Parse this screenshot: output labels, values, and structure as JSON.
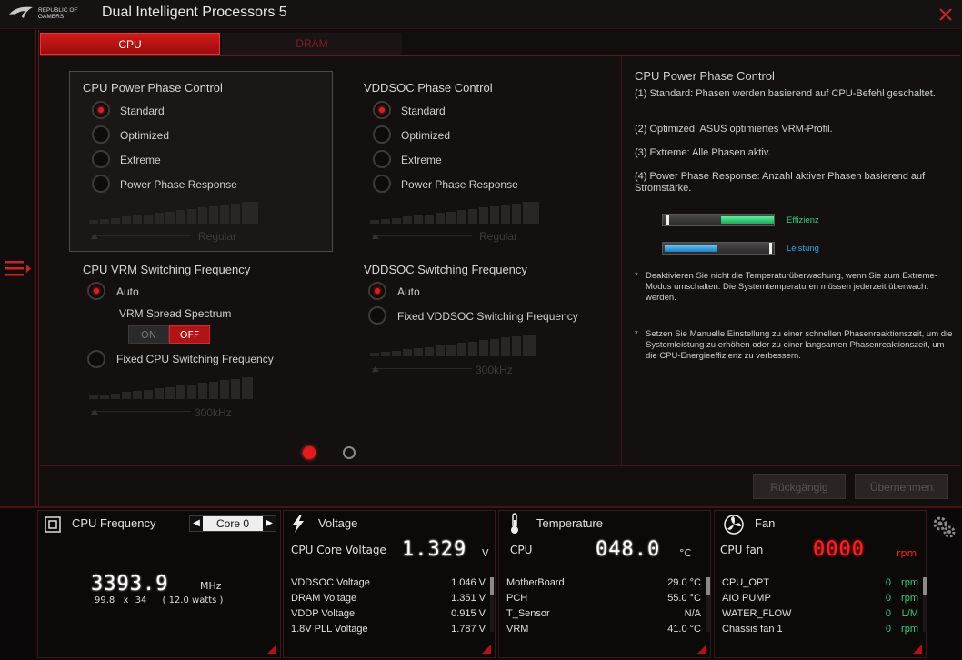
{
  "app": {
    "brand_line1": "REPUBLIC OF",
    "brand_line2": "GAMERS",
    "title": "Dual Intelligent Processors 5"
  },
  "tabs": [
    {
      "label": "CPU",
      "active": true
    },
    {
      "label": "DRAM",
      "active": false
    }
  ],
  "cpu_phase": {
    "title": "CPU Power Phase Control",
    "options": [
      "Standard",
      "Optimized",
      "Extreme",
      "Power Phase Response"
    ],
    "selected": "Standard",
    "slider_label": "Regular"
  },
  "vddsoc_phase": {
    "title": "VDDSOC Phase Control",
    "options": [
      "Standard",
      "Optimized",
      "Extreme",
      "Power Phase Response"
    ],
    "selected": "Standard",
    "slider_label": "Regular"
  },
  "cpu_vrm": {
    "title": "CPU VRM Switching Frequency",
    "auto_label": "Auto",
    "spread_label": "VRM Spread Spectrum",
    "toggle_on": "ON",
    "toggle_off": "OFF",
    "toggle_state": "OFF",
    "fixed_label": "Fixed CPU Switching Frequency",
    "slider_label": "300kHz",
    "selected": "Auto"
  },
  "vddsoc_sw": {
    "title": "VDDSOC Switching Frequency",
    "auto_label": "Auto",
    "fixed_label": "Fixed VDDSOC Switching Frequency",
    "slider_label": "300kHz",
    "selected": "Auto"
  },
  "pager": {
    "pages": 2,
    "current": 1
  },
  "description": {
    "title": "CPU Power Phase Control",
    "p1": "(1) Standard: Phasen werden basierend auf CPU-Befehl geschaltet.",
    "p2": "(2) Optimized: ASUS optimiertes VRM-Profil.",
    "p3": "(3) Extreme: Alle Phasen aktiv.",
    "p4": "(4) Power Phase Response: Anzahl aktiver Phasen basierend auf Stromstärke.",
    "bar1_label": "Effizienz",
    "bar1_color": "#2fd07a",
    "bar2_label": "Leistung",
    "bar2_color": "#2aa8e0",
    "note1": "Deaktivieren Sie nicht die Temperaturüberwachung, wenn Sie zum Extreme-Modus umschalten. Die Systemtemperaturen müssen jederzeit überwacht werden.",
    "note2": "Setzen Sie Manuelle Einstellung zu einer schnellen Phasenreaktionszeit, um die Systemleistung zu erhöhen oder zu einer langsamen Phasenreaktionszeit, um die CPU-Energieeffizienz zu verbessern.",
    "star": "*"
  },
  "buttons": {
    "undo": "Rückgängig",
    "apply": "Übernehmen"
  },
  "cpu_freq": {
    "title": "CPU Frequency",
    "core_select": "Core 0",
    "value": "3393.9",
    "unit": "MHz",
    "ratio_a": "99.8",
    "ratio_x": "x",
    "ratio_b": "34",
    "watts": "( 12.0 watts )"
  },
  "voltage": {
    "title": "Voltage",
    "main_label": "CPU Core Voltage",
    "main_value": "1.329",
    "main_unit": "V",
    "rows": [
      {
        "k": "VDDSOC Voltage",
        "v": "1.046  V"
      },
      {
        "k": "DRAM Voltage",
        "v": "1.351  V"
      },
      {
        "k": "VDDP Voltage",
        "v": "0.915  V"
      },
      {
        "k": "1.8V PLL Voltage",
        "v": "1.787  V"
      }
    ]
  },
  "temperature": {
    "title": "Temperature",
    "main_label": "CPU",
    "main_value": "048.0",
    "main_unit": "°C",
    "rows": [
      {
        "k": "MotherBoard",
        "v": "29.0 °C"
      },
      {
        "k": "PCH",
        "v": "55.0 °C"
      },
      {
        "k": "T_Sensor",
        "v": "N/A"
      },
      {
        "k": "VRM",
        "v": "41.0 °C"
      }
    ]
  },
  "fan": {
    "title": "Fan",
    "main_label": "CPU fan",
    "main_value": "0000",
    "main_unit": "rpm",
    "rows": [
      {
        "k": "CPU_OPT",
        "n": "0",
        "u": "rpm"
      },
      {
        "k": "AIO PUMP",
        "n": "0",
        "u": "rpm"
      },
      {
        "k": "WATER_FLOW",
        "n": "0",
        "u": "L/M"
      },
      {
        "k": "Chassis fan 1",
        "n": "0",
        "u": "rpm"
      }
    ]
  },
  "colors": {
    "accent": "#d11a1a",
    "green": "#2fd07a",
    "fan_red": "#ff2020"
  }
}
